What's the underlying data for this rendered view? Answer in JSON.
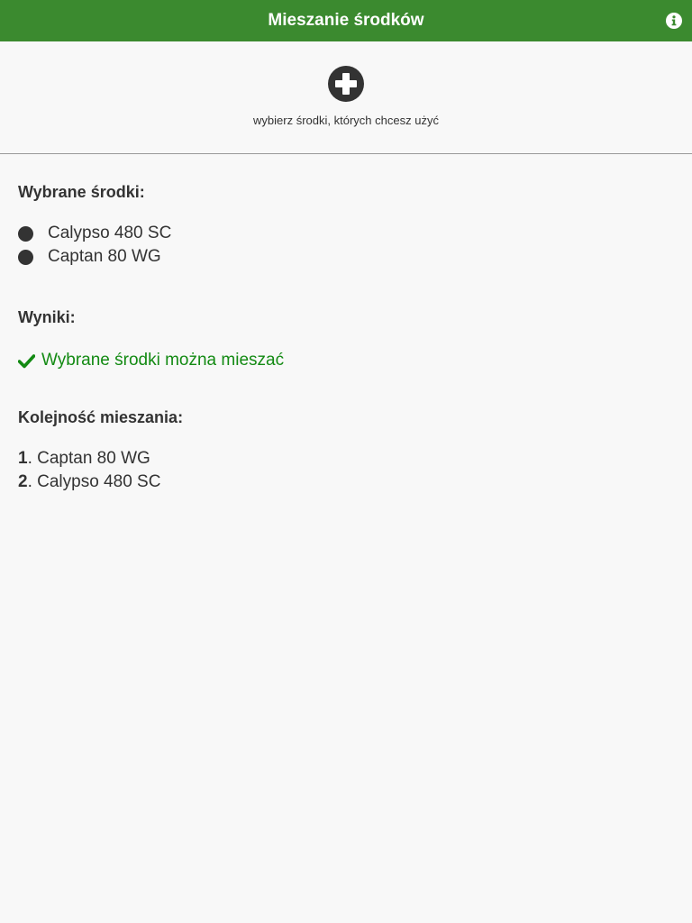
{
  "header": {
    "title": "Mieszanie środków",
    "info_icon": "info-icon"
  },
  "picker": {
    "add_icon": "plus-circle-icon",
    "hint": "wybierz środki, których chcesz użyć"
  },
  "selected": {
    "heading": "Wybrane środki:",
    "items": [
      {
        "label": "Calypso 480 SC"
      },
      {
        "label": "Captan 80 WG"
      }
    ]
  },
  "results": {
    "heading": "Wyniki:",
    "status_icon": "checkmark-icon",
    "message": "Wybrane środki można mieszać"
  },
  "order": {
    "heading": "Kolejność mieszania:",
    "items": [
      {
        "num": "1",
        "label": ". Captan 80 WG"
      },
      {
        "num": "2",
        "label": ". Calypso 480 SC"
      }
    ]
  },
  "colors": {
    "header_bg": "#3b8a2f",
    "success": "#138a13",
    "text": "#333333",
    "background": "#f8f8f8"
  }
}
